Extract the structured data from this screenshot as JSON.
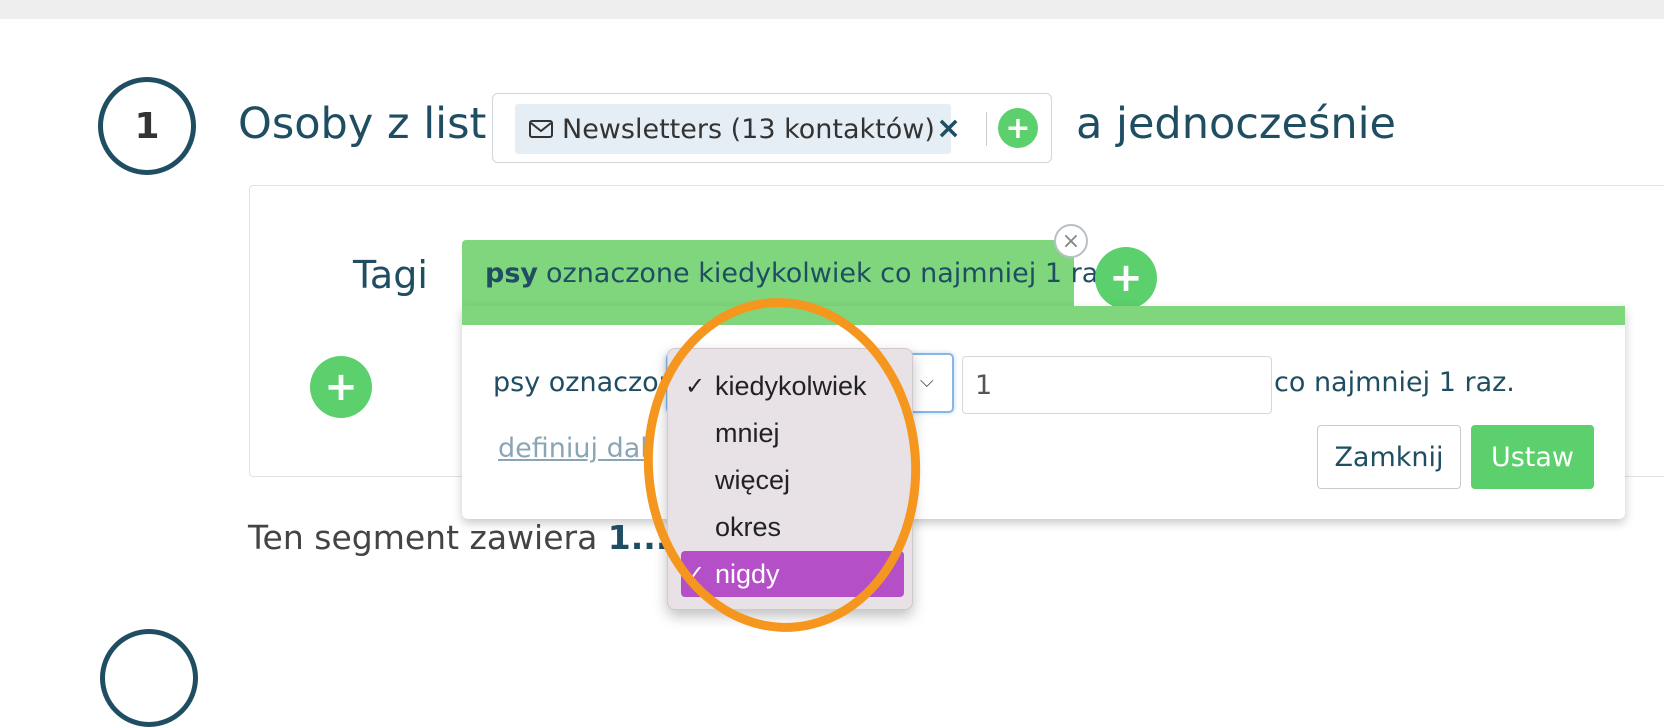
{
  "step1": {
    "number": "1",
    "heading": "Osoby z list",
    "list_chip": "Newsletters (13 kontaktów)",
    "chip_remove": "×",
    "add": "+",
    "connector": "a jednocześnie"
  },
  "tags": {
    "label": "Tagi",
    "tab_name": "psy",
    "tab_text": "oznaczone kiedykolwiek co najmniej 1 raz",
    "tab_close": "×",
    "add": "+"
  },
  "popover": {
    "condition_label": "psy oznaczon",
    "quantity_value": "1",
    "suffix": "co najmniej 1 raz.",
    "define_link": "definiuj dal",
    "close_button": "Zamknij",
    "set_button": "Ustaw"
  },
  "dropdown": {
    "options": [
      {
        "label": "kiedykolwiek",
        "check": "✓"
      },
      {
        "label": "mniej",
        "check": ""
      },
      {
        "label": "więcej",
        "check": ""
      },
      {
        "label": "okres",
        "check": ""
      },
      {
        "label": "nigdy",
        "check": "✓"
      }
    ],
    "highlighted": "nigdy"
  },
  "segment": {
    "prefix": "Ten segment zawiera ",
    "count": "1..."
  },
  "colors": {
    "accent_green": "#5cd06c",
    "tag_green": "#7fd67c",
    "heading": "#1f4e63",
    "highlight_orange": "#f5961e",
    "selected_option": "#b44fc7"
  }
}
